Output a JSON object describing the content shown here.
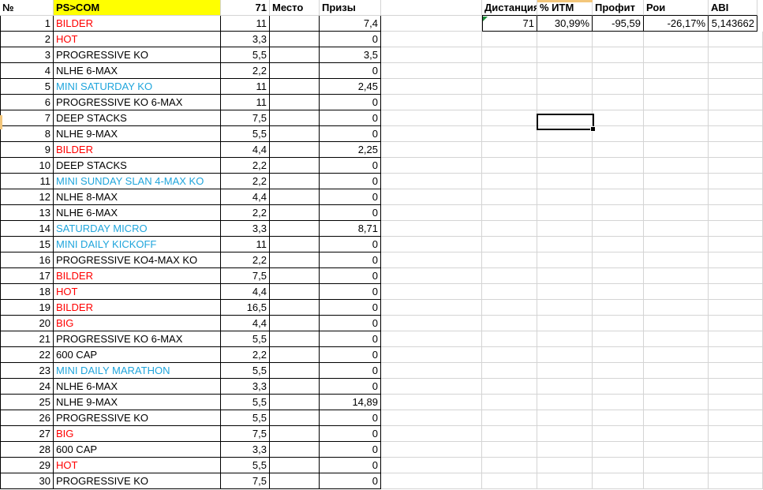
{
  "sheet": {
    "headers": [
      "№",
      "PS>COM",
      "71",
      "Место",
      "Призы"
    ],
    "rows": [
      {
        "n": "1",
        "name": "BILDER",
        "buyin": "11",
        "place": "",
        "prize": "7,4",
        "color": "red"
      },
      {
        "n": "2",
        "name": "HOT",
        "buyin": "3,3",
        "place": "",
        "prize": "0",
        "color": "red"
      },
      {
        "n": "3",
        "name": "PROGRESSIVE KO",
        "buyin": "5,5",
        "place": "",
        "prize": "3,5",
        "color": "black"
      },
      {
        "n": "4",
        "name": "NLHE 6-MAX",
        "buyin": "2,2",
        "place": "",
        "prize": "0",
        "color": "black"
      },
      {
        "n": "5",
        "name": "MINI SATURDAY KO",
        "buyin": "11",
        "place": "",
        "prize": "2,45",
        "color": "blue"
      },
      {
        "n": "6",
        "name": "PROGRESSIVE KO 6-MAX",
        "buyin": "11",
        "place": "",
        "prize": "0",
        "color": "black"
      },
      {
        "n": "7",
        "name": "DEEP STACKS",
        "buyin": "7,5",
        "place": "",
        "prize": "0",
        "color": "black"
      },
      {
        "n": "8",
        "name": "NLHE 9-MAX",
        "buyin": "5,5",
        "place": "",
        "prize": "0",
        "color": "black"
      },
      {
        "n": "9",
        "name": "BILDER",
        "buyin": "4,4",
        "place": "",
        "prize": "2,25",
        "color": "red"
      },
      {
        "n": "10",
        "name": "DEEP STACKS",
        "buyin": "2,2",
        "place": "",
        "prize": "0",
        "color": "black"
      },
      {
        "n": "11",
        "name": "MINI SUNDAY SLAN 4-MAX KO",
        "buyin": "2,2",
        "place": "",
        "prize": "0",
        "color": "blue"
      },
      {
        "n": "12",
        "name": "NLHE 8-MAX",
        "buyin": "4,4",
        "place": "",
        "prize": "0",
        "color": "black"
      },
      {
        "n": "13",
        "name": "NLHE 6-MAX",
        "buyin": "2,2",
        "place": "",
        "prize": "0",
        "color": "black"
      },
      {
        "n": "14",
        "name": "SATURDAY MICRO",
        "buyin": "3,3",
        "place": "",
        "prize": "8,71",
        "color": "blue"
      },
      {
        "n": "15",
        "name": "MINI DAILY KICKOFF",
        "buyin": "11",
        "place": "",
        "prize": "0",
        "color": "blue"
      },
      {
        "n": "16",
        "name": "PROGRESSIVE KO4-MAX KO",
        "buyin": "2,2",
        "place": "",
        "prize": "0",
        "color": "black"
      },
      {
        "n": "17",
        "name": "BILDER",
        "buyin": "7,5",
        "place": "",
        "prize": "0",
        "color": "red"
      },
      {
        "n": "18",
        "name": "HOT",
        "buyin": "4,4",
        "place": "",
        "prize": "0",
        "color": "red"
      },
      {
        "n": "19",
        "name": "BILDER",
        "buyin": "16,5",
        "place": "",
        "prize": "0",
        "color": "red"
      },
      {
        "n": "20",
        "name": "BIG",
        "buyin": "4,4",
        "place": "",
        "prize": "0",
        "color": "red"
      },
      {
        "n": "21",
        "name": "PROGRESSIVE KO 6-MAX",
        "buyin": "5,5",
        "place": "",
        "prize": "0",
        "color": "black"
      },
      {
        "n": "22",
        "name": "600 CAP",
        "buyin": "2,2",
        "place": "",
        "prize": "0",
        "color": "black"
      },
      {
        "n": "23",
        "name": "MINI DAILY MARATHON",
        "buyin": "5,5",
        "place": "",
        "prize": "0",
        "color": "blue"
      },
      {
        "n": "24",
        "name": "NLHE 6-MAX",
        "buyin": "3,3",
        "place": "",
        "prize": "0",
        "color": "black"
      },
      {
        "n": "25",
        "name": "NLHE 9-MAX",
        "buyin": "5,5",
        "place": "",
        "prize": "14,89",
        "color": "black"
      },
      {
        "n": "26",
        "name": "PROGRESSIVE KO",
        "buyin": "5,5",
        "place": "",
        "prize": "0",
        "color": "black"
      },
      {
        "n": "27",
        "name": "BIG",
        "buyin": "7,5",
        "place": "",
        "prize": "0",
        "color": "red"
      },
      {
        "n": "28",
        "name": "600 CAP",
        "buyin": "3,3",
        "place": "",
        "prize": "0",
        "color": "black"
      },
      {
        "n": "29",
        "name": "HOT",
        "buyin": "5,5",
        "place": "",
        "prize": "0",
        "color": "red"
      },
      {
        "n": "30",
        "name": "PROGRESSIVE KO",
        "buyin": "7,5",
        "place": "",
        "prize": "0",
        "color": "black"
      }
    ]
  },
  "summary": {
    "headers": [
      "Дистанция",
      "% ИТМ",
      "Профит",
      "Рои",
      "ABI"
    ],
    "values": [
      "71",
      "30,99%",
      "-95,59",
      "-26,17%",
      "5,143662"
    ]
  },
  "colors": {
    "red": "#ff0000",
    "blue": "#1fa5dc",
    "header_fill": "#ffff00",
    "gridline": "#d4d4d4",
    "indicator": "#f3c67a"
  }
}
